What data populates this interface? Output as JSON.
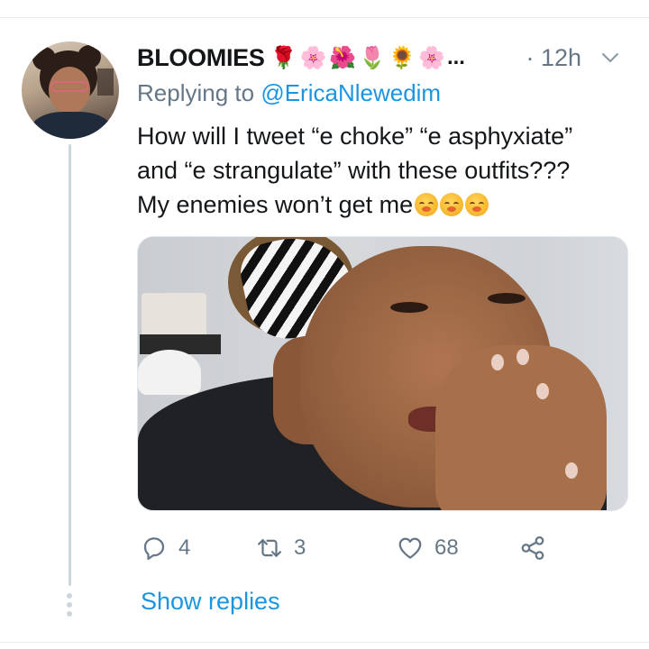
{
  "tweet": {
    "author_name": "BLOOMIES",
    "name_emojis": [
      {
        "char": "🌹",
        "icon": "rose-emoji",
        "cls": "e-rose"
      },
      {
        "char": "🌸",
        "icon": "cherry-blossom-emoji",
        "cls": "e-blossom"
      },
      {
        "char": "🌺",
        "icon": "hibiscus-emoji",
        "cls": "e-hibiscus"
      },
      {
        "char": "🌷",
        "icon": "tulip-emoji",
        "cls": "e-tulip"
      },
      {
        "char": "🌻",
        "icon": "sunflower-emoji",
        "cls": "e-sunflower"
      },
      {
        "char": "🌸",
        "icon": "cherry-blossom-emoji",
        "cls": "e-flower2"
      }
    ],
    "name_truncation": "...",
    "timestamp": "· 12h",
    "replying_to_prefix": "Replying to ",
    "replying_to_handle": "@EricaNlewedim",
    "text_lines": [
      "How will I tweet “e choke” “e asphyxiate”",
      "and “e strangulate” with these outfits???",
      "My enemies won’t get me"
    ],
    "text_trailing_emojis": [
      "flushed-face-emoji",
      "flushed-face-emoji",
      "flushed-face-emoji"
    ],
    "stats": {
      "replies": "4",
      "retweets": "3",
      "likes": "68"
    },
    "show_replies_label": "Show replies"
  },
  "colors": {
    "link_blue": "#1b95e0",
    "secondary_text": "#657786",
    "primary_text": "#14171a",
    "thread_line": "#ccd6dd"
  },
  "icons": {
    "reply": "reply-icon",
    "retweet": "retweet-icon",
    "like": "heart-icon",
    "share": "share-icon",
    "more": "chevron-down-icon"
  }
}
